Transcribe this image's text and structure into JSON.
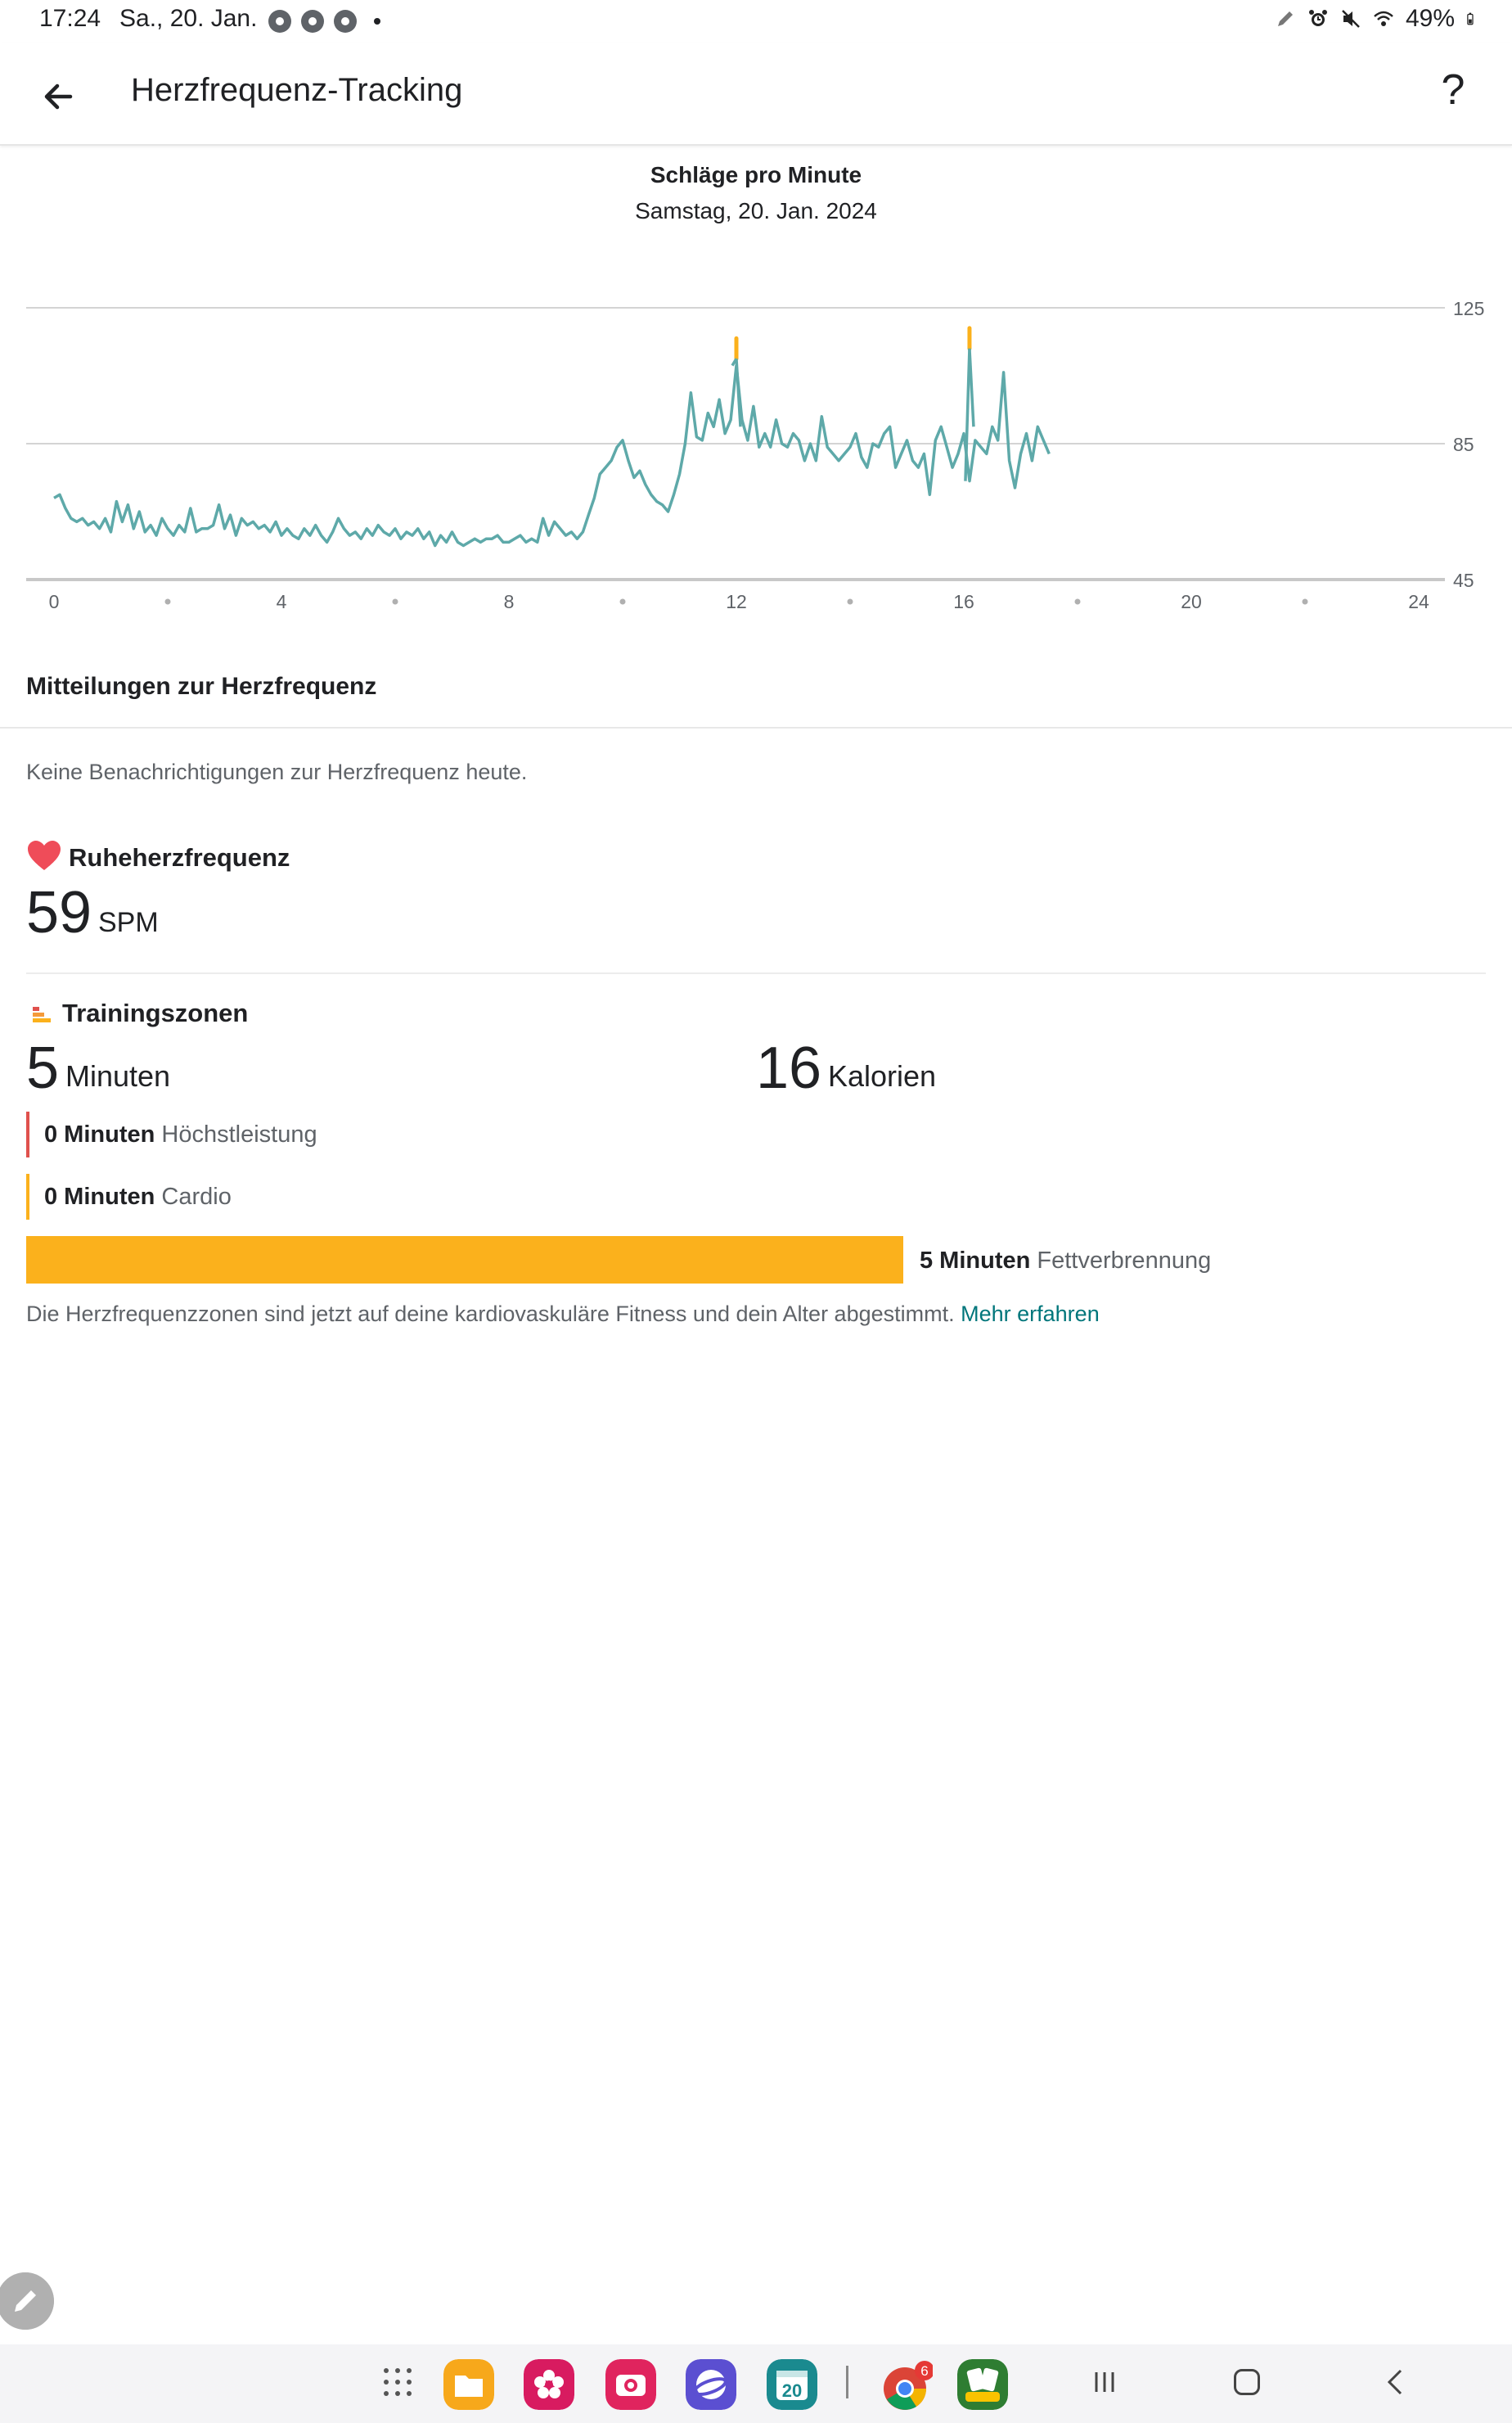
{
  "status_bar": {
    "time": "17:24",
    "date": "Sa., 20. Jan.",
    "battery": "49%"
  },
  "app_bar": {
    "title": "Herzfrequenz-Tracking",
    "help": "?"
  },
  "chart_data": {
    "type": "line",
    "title": "Schläge pro Minute",
    "subtitle": "Samstag, 20. Jan. 2024",
    "xlabel": "",
    "ylabel": "",
    "xlim": [
      0,
      24
    ],
    "ylim": [
      45,
      125
    ],
    "x_ticks": [
      "0",
      "4",
      "8",
      "12",
      "16",
      "20",
      "24"
    ],
    "y_ticks": [
      "45",
      "85",
      "125"
    ],
    "grid": true,
    "series": [
      {
        "color": "#5ea9a9",
        "highlight_color": "#fbb11c",
        "x": [
          0.0,
          0.1,
          0.2,
          0.3,
          0.4,
          0.5,
          0.6,
          0.7,
          0.8,
          0.9,
          1.0,
          1.1,
          1.2,
          1.3,
          1.4,
          1.5,
          1.6,
          1.7,
          1.8,
          1.9,
          2.0,
          2.1,
          2.2,
          2.3,
          2.4,
          2.5,
          2.6,
          2.7,
          2.8,
          2.9,
          3.0,
          3.1,
          3.2,
          3.3,
          3.4,
          3.5,
          3.6,
          3.7,
          3.8,
          3.9,
          4.0,
          4.1,
          4.2,
          4.3,
          4.4,
          4.5,
          4.6,
          4.7,
          4.8,
          4.9,
          5.0,
          5.1,
          5.2,
          5.3,
          5.4,
          5.5,
          5.6,
          5.7,
          5.8,
          5.9,
          6.0,
          6.1,
          6.2,
          6.3,
          6.4,
          6.5,
          6.6,
          6.7,
          6.8,
          6.9,
          7.0,
          7.1,
          7.2,
          7.3,
          7.4,
          7.5,
          7.6,
          7.7,
          7.8,
          7.9,
          8.0,
          8.1,
          8.2,
          8.3,
          8.4,
          8.5,
          8.6,
          8.7,
          8.8,
          8.9,
          9.0,
          9.1,
          9.2,
          9.3,
          9.4,
          9.5,
          9.6,
          9.7,
          9.8,
          9.9,
          10.0,
          10.1,
          10.2,
          10.3,
          10.4,
          10.5,
          10.6,
          10.7,
          10.8,
          10.9,
          11.0,
          11.1,
          11.2,
          11.3,
          11.4,
          11.5,
          11.6,
          11.7,
          11.8,
          11.9,
          12.0,
          12.1,
          12.2,
          12.3,
          12.4,
          12.5,
          12.6,
          12.7,
          12.8,
          12.9,
          13.0,
          13.1,
          13.2,
          13.3,
          13.4,
          13.5,
          13.6,
          13.7,
          13.8,
          13.9,
          14.0,
          14.1,
          14.2,
          14.3,
          14.4,
          14.5,
          14.6,
          14.7,
          14.8,
          14.9,
          15.0,
          15.1,
          15.2,
          15.3,
          15.4,
          15.5,
          15.6,
          15.7,
          15.8,
          15.9,
          16.0,
          16.1,
          16.2,
          16.3,
          16.4,
          16.5,
          16.6,
          16.7,
          16.8,
          16.9,
          17.0,
          17.1,
          17.2,
          17.3,
          17.4,
          17.5
        ],
        "y": [
          69,
          70,
          66,
          63,
          62,
          63,
          61,
          62,
          60,
          63,
          59,
          68,
          62,
          67,
          60,
          65,
          59,
          61,
          58,
          63,
          60,
          58,
          61,
          59,
          66,
          59,
          60,
          60,
          61,
          67,
          60,
          64,
          58,
          63,
          61,
          62,
          60,
          61,
          59,
          62,
          58,
          60,
          58,
          57,
          60,
          58,
          61,
          58,
          56,
          59,
          63,
          60,
          58,
          59,
          57,
          60,
          58,
          61,
          59,
          58,
          60,
          57,
          59,
          58,
          60,
          57,
          59,
          55,
          58,
          56,
          59,
          56,
          55,
          56,
          57,
          56,
          57,
          57,
          58,
          56,
          56,
          57,
          58,
          56,
          57,
          56,
          63,
          58,
          62,
          60,
          58,
          59,
          57,
          59,
          64,
          69,
          76,
          78,
          80,
          84,
          86,
          80,
          75,
          77,
          73,
          70,
          68,
          67,
          65,
          70,
          76,
          85,
          100,
          87,
          86,
          94,
          90,
          98,
          88,
          92,
          108,
          92,
          86,
          96,
          84,
          88,
          84,
          92,
          85,
          84,
          88,
          86,
          80,
          85,
          80,
          93,
          84,
          82,
          80,
          82,
          84,
          88,
          81,
          78,
          85,
          84,
          88,
          90,
          78,
          82,
          86,
          80,
          78,
          82,
          70,
          86,
          90,
          84,
          78,
          82,
          88,
          74,
          86,
          84,
          82,
          90,
          86,
          106,
          80,
          72,
          82,
          88,
          80,
          90,
          86,
          82
        ],
        "highlight_points": [
          [
            12.0,
            116
          ],
          [
            16.1,
            119
          ]
        ]
      }
    ]
  },
  "notifications": {
    "heading": "Mitteilungen zur Herzfrequenz",
    "text": "Keine Benachrichtigungen zur Herzfrequenz heute."
  },
  "resting_hr": {
    "heading": "Ruheherzfrequenz",
    "value": "59",
    "unit": "SPM"
  },
  "training_zones": {
    "heading": "Trainingszonen",
    "minutes_value": "5",
    "minutes_unit": "Minuten",
    "calories_value": "16",
    "calories_unit": "Kalorien",
    "zones": [
      {
        "minutes": "0 Minuten",
        "label": "Höchstleistung",
        "color": "#e0514d"
      },
      {
        "minutes": "0 Minuten",
        "label": "Cardio",
        "color": "#fbb11c"
      }
    ],
    "fat_burn": {
      "minutes": "5 Minuten",
      "label": "Fettverbrennung",
      "color": "#fbb11c"
    },
    "footnote": "Die Herzfrequenzzonen sind jetzt auf deine kardiovaskuläre Fitness und dein Alter abgestimmt.",
    "learn_more": "Mehr erfahren"
  },
  "nav_bar": {
    "dock_apps": [
      {
        "name": "app-drawer-icon",
        "color": "#ffffff"
      },
      {
        "name": "files-app-icon",
        "color": "#f7a81b"
      },
      {
        "name": "gallery-app-icon",
        "color": "#d81b60"
      },
      {
        "name": "camera-app-icon",
        "color": "#e0245e"
      },
      {
        "name": "internet-app-icon",
        "color": "#5b4fd1"
      },
      {
        "name": "calendar-app-icon",
        "color": "#1a8a8f"
      },
      {
        "name": "chrome-app-icon",
        "color": "#4285f4"
      },
      {
        "name": "solitaire-app-icon",
        "color": "#2e7d32"
      }
    ],
    "calendar_day": "20",
    "chrome_badge": "6"
  }
}
